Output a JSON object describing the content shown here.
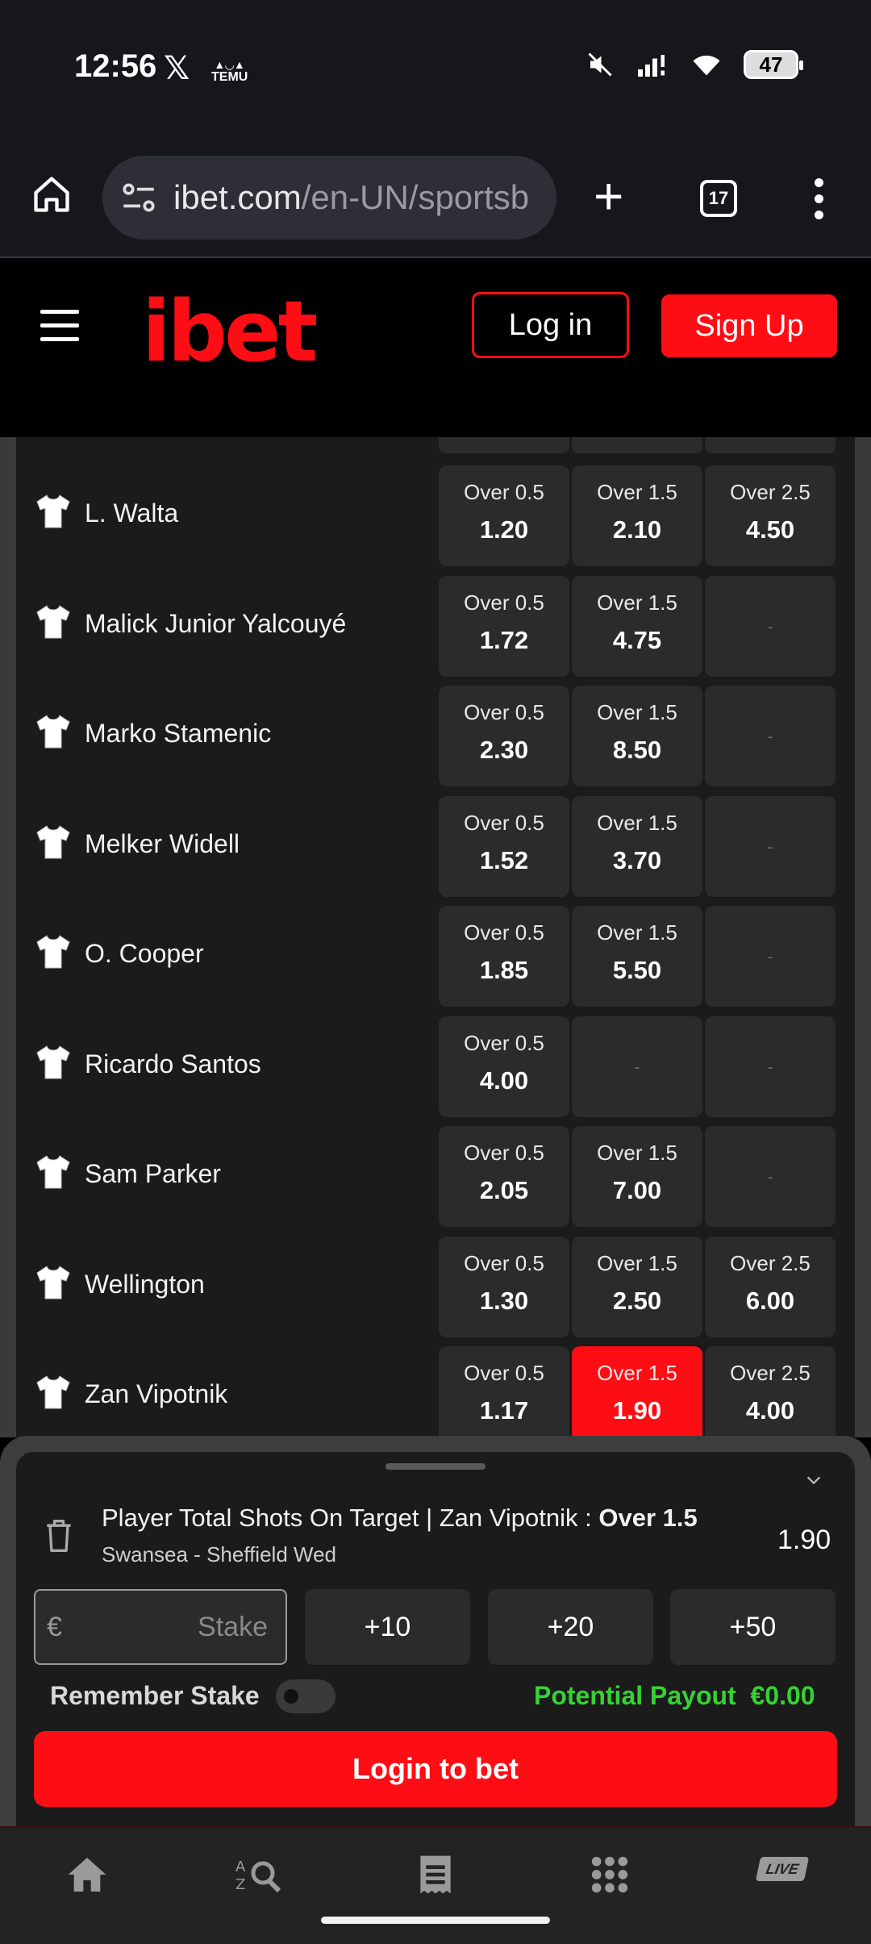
{
  "status_bar": {
    "time": "12:56",
    "x_app": "𝕏",
    "temu_label": "TEMU",
    "battery": "47"
  },
  "browser": {
    "url_main": "ibet.com",
    "url_path": "/en-UN/sportsb",
    "tab_count": "17"
  },
  "header": {
    "logo": "ibet",
    "login_label": "Log in",
    "signup_label": "Sign Up"
  },
  "players": [
    {
      "name": "L. Walta",
      "odds": [
        {
          "label": "Over 0.5",
          "value": "1.20"
        },
        {
          "label": "Over 1.5",
          "value": "2.10"
        },
        {
          "label": "Over 2.5",
          "value": "4.50"
        }
      ]
    },
    {
      "name": "Malick Junior Yalcouyé",
      "odds": [
        {
          "label": "Over 0.5",
          "value": "1.72"
        },
        {
          "label": "Over 1.5",
          "value": "4.75"
        },
        {
          "label": "",
          "value": "-"
        }
      ]
    },
    {
      "name": "Marko Stamenic",
      "odds": [
        {
          "label": "Over 0.5",
          "value": "2.30"
        },
        {
          "label": "Over 1.5",
          "value": "8.50"
        },
        {
          "label": "",
          "value": "-"
        }
      ]
    },
    {
      "name": "Melker Widell",
      "odds": [
        {
          "label": "Over 0.5",
          "value": "1.52"
        },
        {
          "label": "Over 1.5",
          "value": "3.70"
        },
        {
          "label": "",
          "value": "-"
        }
      ]
    },
    {
      "name": "O. Cooper",
      "odds": [
        {
          "label": "Over 0.5",
          "value": "1.85"
        },
        {
          "label": "Over 1.5",
          "value": "5.50"
        },
        {
          "label": "",
          "value": "-"
        }
      ]
    },
    {
      "name": "Ricardo Santos",
      "odds": [
        {
          "label": "Over 0.5",
          "value": "4.00"
        },
        {
          "label": "",
          "value": "-"
        },
        {
          "label": "",
          "value": "-"
        }
      ]
    },
    {
      "name": "Sam Parker",
      "odds": [
        {
          "label": "Over 0.5",
          "value": "2.05"
        },
        {
          "label": "Over 1.5",
          "value": "7.00"
        },
        {
          "label": "",
          "value": "-"
        }
      ]
    },
    {
      "name": "Wellington",
      "odds": [
        {
          "label": "Over 0.5",
          "value": "1.30"
        },
        {
          "label": "Over 1.5",
          "value": "2.50"
        },
        {
          "label": "Over 2.5",
          "value": "6.00"
        }
      ]
    },
    {
      "name": "Zan Vipotnik",
      "odds": [
        {
          "label": "Over 0.5",
          "value": "1.17"
        },
        {
          "label": "Over 1.5",
          "value": "1.90",
          "selected": true
        },
        {
          "label": "Over 2.5",
          "value": "4.00"
        }
      ]
    }
  ],
  "betslip": {
    "market_prefix": "Player Total Shots On Target | Zan Vipotnik : ",
    "market_selection": "Over 1.5",
    "match": "Swansea - Sheffield Wed",
    "odd": "1.90",
    "currency": "€",
    "stake_placeholder": "Stake",
    "quick_stakes": [
      "+10",
      "+20",
      "+50"
    ],
    "remember_label": "Remember Stake",
    "payout_label": "Potential Payout",
    "payout_value": "€0.00",
    "login_to_bet": "Login to bet"
  },
  "bottom_nav": {
    "icons": [
      "home-icon",
      "az-search-icon",
      "betslip-icon",
      "grid-icon",
      "live-icon"
    ],
    "live_label": "LIVE"
  },
  "colors": {
    "brand_red": "#ff0d14",
    "payout_green": "#35d135",
    "panel_bg": "#1b1b1b",
    "odd_bg": "#2b2b2b"
  }
}
